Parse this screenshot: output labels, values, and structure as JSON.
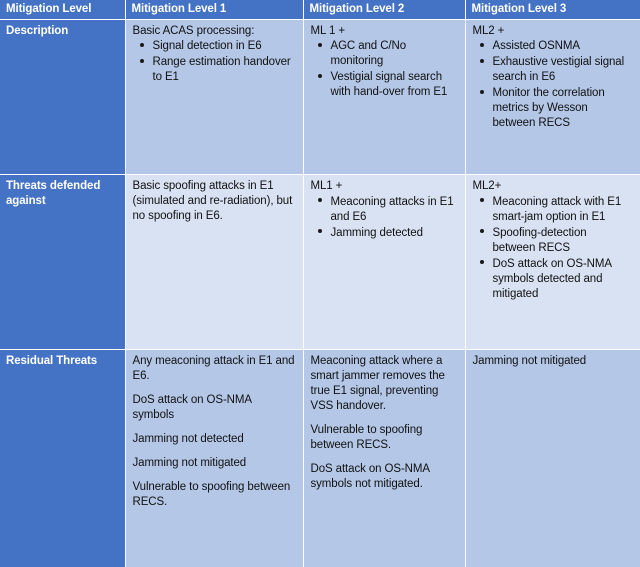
{
  "colors": {
    "header_blue": "#4472C4",
    "cell_mid_blue": "#B4C7E7",
    "cell_pale_blue": "#D9E2F3",
    "text_dark": "#111111",
    "text_light": "#FFFFFF"
  },
  "table": {
    "headers": [
      "Mitigation Level",
      "Mitigation Level 1",
      "Mitigation Level 2",
      "Mitigation Level 3"
    ],
    "rows": [
      {
        "label": "Description",
        "ml1": {
          "lead": "Basic ACAS processing:",
          "bullets": [
            "Signal detection in E6",
            "Range estimation handover to E1"
          ]
        },
        "ml2": {
          "lead": "ML 1 +",
          "bullets": [
            "AGC and C/No monitoring",
            "Vestigial signal search with hand-over from E1"
          ]
        },
        "ml3": {
          "lead": "ML2 +",
          "bullets": [
            "Assisted OSNMA",
            "Exhaustive vestigial signal search in E6",
            "Monitor the correlation metrics by Wesson between RECS"
          ]
        }
      },
      {
        "label": "Threats defended against",
        "ml1": {
          "lead": "Basic spoofing attacks in E1 (simulated and re-radiation), but no spoofing in E6.",
          "bullets": []
        },
        "ml2": {
          "lead": "ML1 +",
          "bullets": [
            "Meaconing attacks in E1 and E6",
            "Jamming detected"
          ]
        },
        "ml3": {
          "lead": "ML2+",
          "bullets": [
            "Meaconing attack with E1 smart-jam option in E1",
            "Spoofing-detection between RECS",
            "DoS attack on OS-NMA symbols detected and mitigated"
          ]
        }
      },
      {
        "label": "Residual Threats",
        "ml1": {
          "paragraphs": [
            "Any meaconing attack in E1 and E6.",
            "DoS attack on OS-NMA symbols",
            "Jamming not detected",
            "Jamming not mitigated",
            "Vulnerable to spoofing between RECS."
          ]
        },
        "ml2": {
          "paragraphs": [
            "Meaconing attack where a smart jammer removes the true E1 signal, preventing VSS handover.",
            "Vulnerable to spoofing between RECS.",
            "DoS attack on OS-NMA symbols not mitigated."
          ]
        },
        "ml3": {
          "paragraphs": [
            "Jamming not mitigated"
          ]
        }
      }
    ]
  }
}
